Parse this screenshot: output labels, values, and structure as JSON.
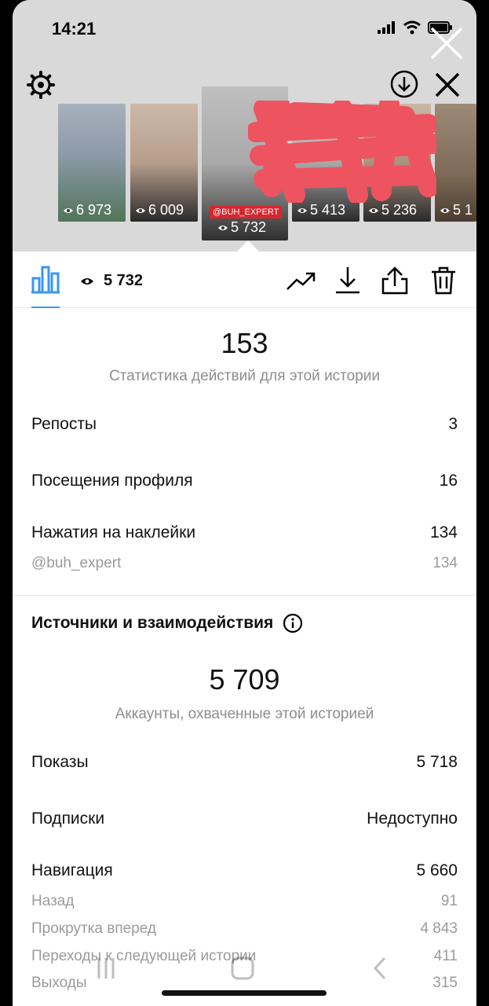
{
  "status_bar": {
    "time": "14:21"
  },
  "stories": [
    {
      "views": "6 973"
    },
    {
      "views": "6 009"
    },
    {
      "views": "5 732",
      "tag": "@BUH_EXPERT",
      "active": true
    },
    {
      "views": "5 413"
    },
    {
      "views": "5 236"
    },
    {
      "views": "5 1"
    }
  ],
  "toolbar": {
    "views": "5 732"
  },
  "actions": {
    "count": "153",
    "caption": "Статистика действий для этой истории",
    "rows": [
      {
        "label": "Репосты",
        "value": "3"
      },
      {
        "label": "Посещения профиля",
        "value": "16"
      },
      {
        "label": "Нажатия на наклейки",
        "value": "134"
      }
    ],
    "sticker_sub": {
      "label": "@buh_expert",
      "value": "134"
    }
  },
  "sources": {
    "title": "Источники и взаимодействия",
    "reach": "5 709",
    "reach_caption": "Аккаунты, охваченные этой историей",
    "impressions": {
      "label": "Показы",
      "value": "5 718"
    },
    "follows": {
      "label": "Подписки",
      "value": "Недоступно"
    },
    "navigation": {
      "label": "Навигация",
      "value": "5 660"
    },
    "nav_rows": [
      {
        "label": "Назад",
        "value": "91"
      },
      {
        "label": "Прокрутка вперед",
        "value": "4 843"
      },
      {
        "label": "Переходы к следующей истории",
        "value": "411"
      },
      {
        "label": "Выходы",
        "value": "315"
      }
    ]
  },
  "colors": {
    "accent": "#3897f0",
    "muted": "#8e8e8e",
    "tag": "#d7262e"
  }
}
